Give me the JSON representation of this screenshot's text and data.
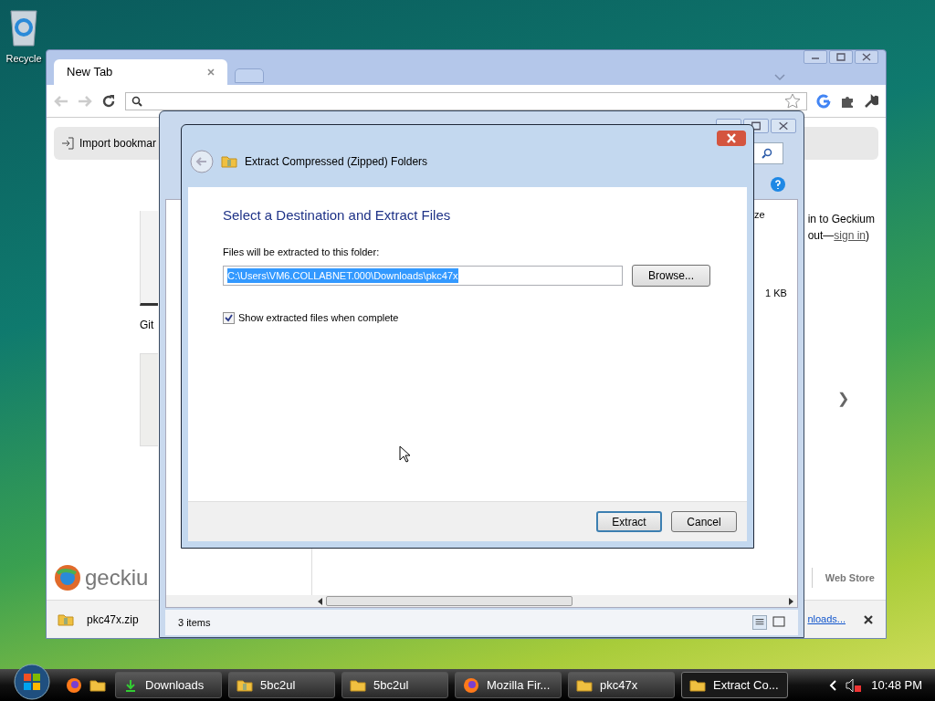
{
  "desktop": {
    "icons": [
      {
        "label": "Recycle"
      }
    ]
  },
  "browser": {
    "tabs": [
      {
        "label": "New Tab",
        "selected": true
      }
    ],
    "bookmark_button": "Import bookmar",
    "thumbnails": [
      {
        "label": "Git"
      }
    ],
    "sign_in": {
      "line_1": "in to Geckium",
      "line_2": "out—",
      "link": "sign in",
      "line_2_end": ")"
    },
    "next_arrow": "❯",
    "logo_text": "geckiu",
    "web_store": "Web Store",
    "downloads": {
      "file": "pkc47x.zip",
      "show_all": "nloads..."
    }
  },
  "explorer": {
    "column": "ze",
    "size": "1 KB",
    "status": "3 items"
  },
  "dialog": {
    "title": "Extract Compressed (Zipped) Folders",
    "heading": "Select a Destination and Extract Files",
    "folder_label": "Files will be extracted to this folder:",
    "path": "C:\\Users\\VM6.COLLABNET.000\\Downloads\\pkc47x",
    "path_selected": true,
    "browse": "Browse...",
    "show_files": {
      "label": "Show extracted files when complete",
      "checked": true
    },
    "buttons": [
      {
        "label": "Extract",
        "default": true
      },
      {
        "label": "Cancel",
        "default": false
      }
    ]
  },
  "taskbar": {
    "items": [
      {
        "label": "Downloads",
        "kind": "download",
        "selected": false
      },
      {
        "label": "5bc2ul",
        "kind": "zip",
        "selected": false
      },
      {
        "label": "5bc2ul",
        "kind": "folder",
        "selected": false
      },
      {
        "label": "Mozilla Fir...",
        "kind": "firefox",
        "selected": false
      },
      {
        "label": "pkc47x",
        "kind": "folder",
        "selected": false
      },
      {
        "label": "Extract Co...",
        "kind": "folder",
        "selected": true
      }
    ],
    "clock": "10:48 PM"
  }
}
